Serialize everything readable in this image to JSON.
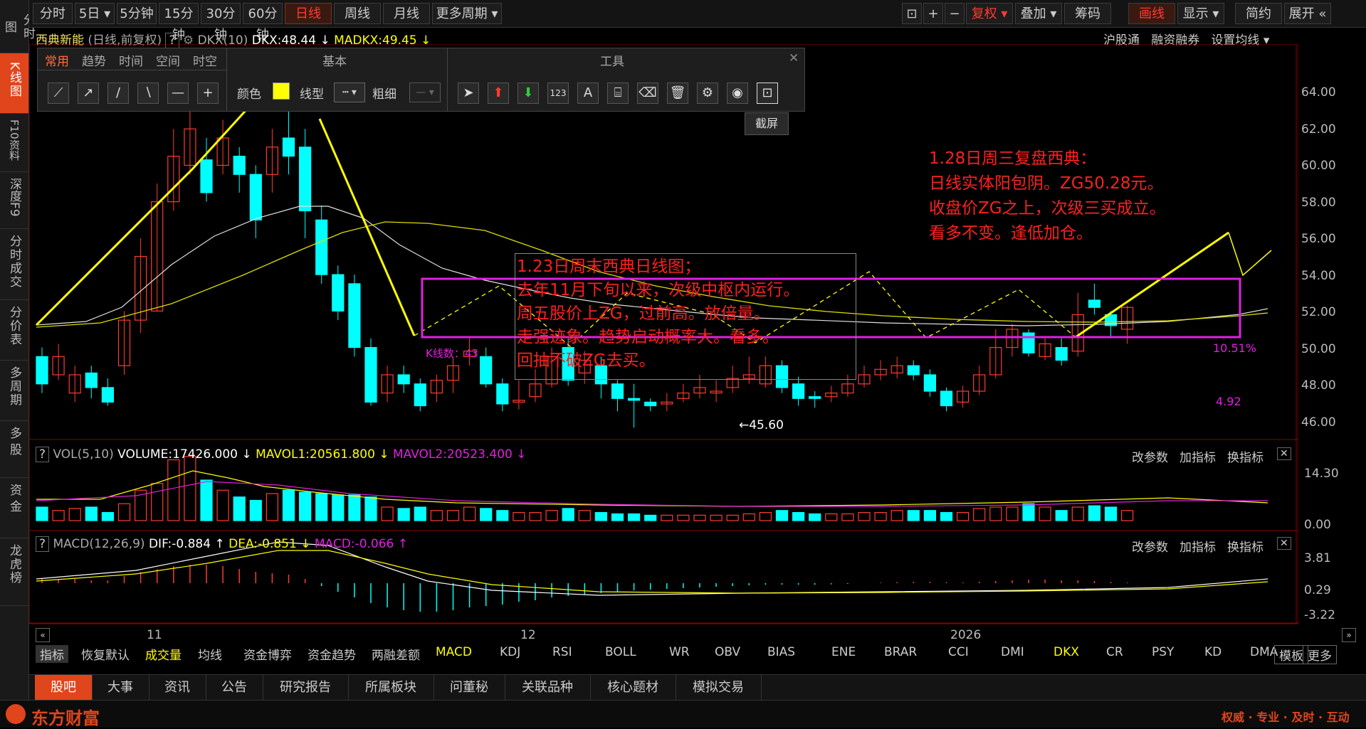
{
  "leftnav": [
    {
      "label": "分时图",
      "active": false
    },
    {
      "label": "K线图",
      "active": true
    },
    {
      "label": "F10资料",
      "active": false
    },
    {
      "label": "深度F9",
      "active": false
    },
    {
      "label": "分时成交",
      "active": false
    },
    {
      "label": "分价表",
      "active": false
    },
    {
      "label": "多周期",
      "active": false
    },
    {
      "label": "多股",
      "active": false
    },
    {
      "label": "资金",
      "active": false
    },
    {
      "label": "龙虎榜",
      "active": false
    }
  ],
  "topbar": {
    "periods": [
      "分时",
      "5日 ▾",
      "5分钟",
      "15分钟",
      "30分钟",
      "60分钟",
      "日线",
      "周线",
      "月线",
      "更多周期 ▾"
    ],
    "active_period": "日线",
    "right": [
      "复权 ▾",
      "叠加 ▾",
      "筹码",
      "画线",
      "显示 ▾",
      "简约",
      "展开 «"
    ],
    "active_right": "画线"
  },
  "infobar": {
    "stock": "西典新能",
    "mode": "(日线,前复权)",
    "help": "?",
    "indicator": "DKX(10)",
    "dkx": "DKX:48.44 ↓",
    "madkx": "MADKX:49.45 ↓",
    "links": [
      "沪股通",
      "融资融券",
      "设置均线 ▾"
    ]
  },
  "drawtoolbar": {
    "tabs": [
      "常用",
      "趋势",
      "时间",
      "空间",
      "时空"
    ],
    "section_basic": "基本",
    "section_tools": "工具",
    "color_label": "颜色",
    "linetype_label": "线型",
    "width_label": "粗细",
    "tooltip": "截屏",
    "close": "✕"
  },
  "price_axis": [
    "64.00",
    "62.00",
    "60.00",
    "58.00",
    "56.00",
    "54.00",
    "52.00",
    "50.00",
    "48.00",
    "46.00"
  ],
  "vol_axis": [
    "14.30",
    "0.00"
  ],
  "macd_axis": [
    "3.81",
    "0.29",
    "-3.22"
  ],
  "date_axis": [
    "11",
    "12",
    "2026"
  ],
  "annotations": {
    "note1": [
      "1.28日周三复盘西典：",
      "日线实体阳包阴。ZG50.28元。",
      "收盘价ZG之上，次级三买成立。",
      "看多不变。逢低加仓。"
    ],
    "note2": [
      "1.23日周末西典日线图；",
      "去年11月下旬以来，次级中枢内运行。",
      "周五股价上ZG，过前高。放倍量。",
      "走强迹象。趋势启动概率大。看多。",
      "回抽不破ZG去买。"
    ],
    "kcount": "K线数：43",
    "pct": "10.51%",
    "diff": "4.92",
    "low": "←45.60"
  },
  "vol_panel": {
    "help": "?",
    "name": "VOL(5,10)",
    "volume": "VOLUME:17426.000 ↓",
    "mavol1": "MAVOL1:20561.800 ↓",
    "mavol2": "MAVOL2:20523.400 ↓",
    "actions": [
      "改参数",
      "加指标",
      "换指标",
      "✕"
    ]
  },
  "macd_panel": {
    "help": "?",
    "name": "MACD(12,26,9)",
    "dif": "DIF:-0.884 ↑",
    "dea": "DEA:-0.851 ↓",
    "macd": "MACD:-0.066 ↑",
    "actions": [
      "改参数",
      "加指标",
      "换指标",
      "✕"
    ]
  },
  "indicators": [
    "指标",
    "恢复默认",
    "成交量",
    "均线",
    "资金博弈",
    "资金趋势",
    "两融差额",
    "MACD",
    "KDJ",
    "RSI",
    "BOLL",
    "WR",
    "OBV",
    "BIAS",
    "ENE",
    "BRAR",
    "CCI",
    "DMI",
    "DKX",
    "CR",
    "PSY",
    "KD",
    "DMA",
    "更多",
    "模板"
  ],
  "bottom_tabs": [
    "股吧",
    "大事",
    "资讯",
    "公告",
    "研究报告",
    "所属板块",
    "问董秘",
    "关联品种",
    "核心题材",
    "模拟交易"
  ],
  "footer": {
    "logo": "东方财富",
    "slogan": "权威 · 专业 · 及时 · 互动"
  },
  "colors": {
    "up": "#ff3b30",
    "down": "#00ffff",
    "accent": "#e1451b",
    "yellow": "#ffff00",
    "magenta": "#e020e0"
  }
}
